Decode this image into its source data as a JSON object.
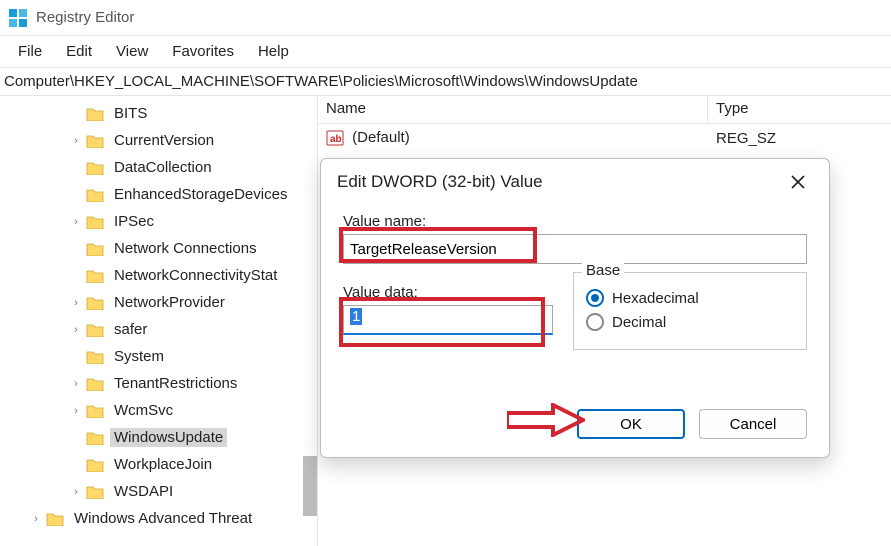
{
  "app": {
    "title": "Registry Editor"
  },
  "menubar": [
    "File",
    "Edit",
    "View",
    "Favorites",
    "Help"
  ],
  "address": "Computer\\HKEY_LOCAL_MACHINE\\SOFTWARE\\Policies\\Microsoft\\Windows\\WindowsUpdate",
  "tree": [
    {
      "label": "BITS",
      "caret": "",
      "depth": 2,
      "selected": false
    },
    {
      "label": "CurrentVersion",
      "caret": ">",
      "depth": 2,
      "selected": false
    },
    {
      "label": "DataCollection",
      "caret": "",
      "depth": 2,
      "selected": false
    },
    {
      "label": "EnhancedStorageDevices",
      "caret": "",
      "depth": 2,
      "selected": false
    },
    {
      "label": "IPSec",
      "caret": ">",
      "depth": 2,
      "selected": false
    },
    {
      "label": "Network Connections",
      "caret": "",
      "depth": 2,
      "selected": false
    },
    {
      "label": "NetworkConnectivityStat",
      "caret": "",
      "depth": 2,
      "selected": false
    },
    {
      "label": "NetworkProvider",
      "caret": ">",
      "depth": 2,
      "selected": false
    },
    {
      "label": "safer",
      "caret": ">",
      "depth": 2,
      "selected": false
    },
    {
      "label": "System",
      "caret": "",
      "depth": 2,
      "selected": false
    },
    {
      "label": "TenantRestrictions",
      "caret": ">",
      "depth": 2,
      "selected": false
    },
    {
      "label": "WcmSvc",
      "caret": ">",
      "depth": 2,
      "selected": false
    },
    {
      "label": "WindowsUpdate",
      "caret": "",
      "depth": 2,
      "selected": true
    },
    {
      "label": "WorkplaceJoin",
      "caret": "",
      "depth": 2,
      "selected": false
    },
    {
      "label": "WSDAPI",
      "caret": ">",
      "depth": 2,
      "selected": false
    },
    {
      "label": "Windows Advanced Threat",
      "caret": ">",
      "depth": 1,
      "selected": false
    }
  ],
  "list": {
    "columns": {
      "name": "Name",
      "type": "Type"
    },
    "rows": [
      {
        "name": "(Default)",
        "type": "REG_SZ",
        "icon": "string"
      }
    ]
  },
  "dialog": {
    "title": "Edit DWORD (32-bit) Value",
    "value_name_label": "Value name:",
    "value_name": "TargetReleaseVersion",
    "value_data_label": "Value data:",
    "value_data": "1",
    "base_label": "Base",
    "base_options": {
      "hex": "Hexadecimal",
      "dec": "Decimal"
    },
    "base_selected": "hex",
    "ok": "OK",
    "cancel": "Cancel"
  }
}
